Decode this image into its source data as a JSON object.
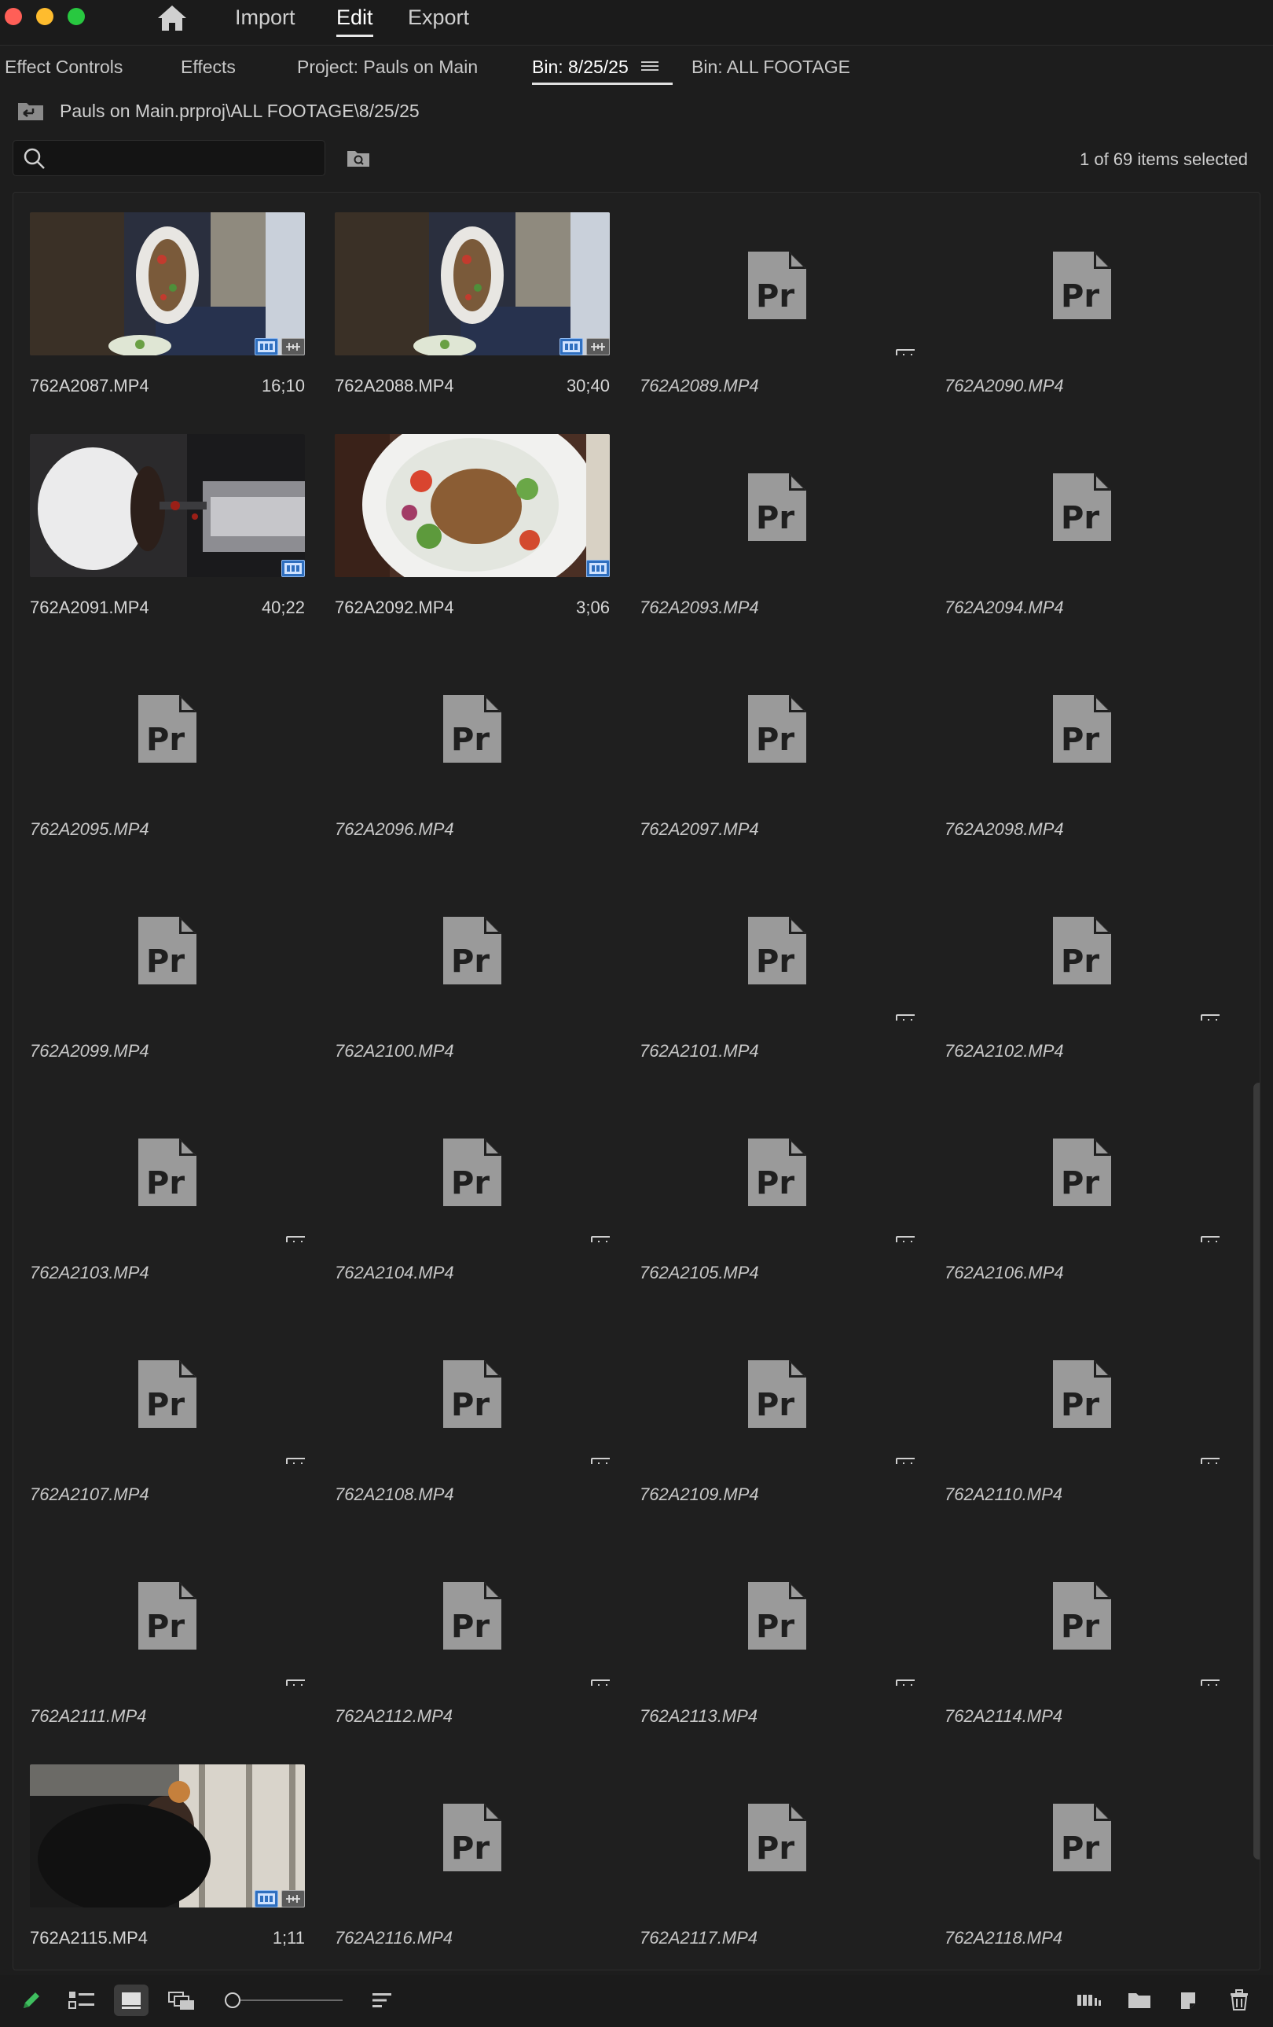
{
  "menu": {
    "tabs": [
      {
        "label": "Import"
      },
      {
        "label": "Edit"
      },
      {
        "label": "Export"
      }
    ]
  },
  "panel_tabs": [
    {
      "label": "Effect Controls"
    },
    {
      "label": "Effects"
    },
    {
      "label": "Project: Pauls on Main"
    },
    {
      "label": "Bin: 8/25/25"
    },
    {
      "label": "Bin: ALL FOOTAGE"
    }
  ],
  "breadcrumb": {
    "path": "Pauls on Main.prproj\\ALL FOOTAGE\\8/25/25"
  },
  "search": {
    "value": "",
    "placeholder": ""
  },
  "status": {
    "items_selected": "1 of 69 items selected"
  },
  "clips": [
    {
      "name": "762A2087.MP4",
      "duration": "16;10",
      "thumbnail": "salad-top",
      "online": true,
      "badges": [
        "video",
        "audio"
      ]
    },
    {
      "name": "762A2088.MP4",
      "duration": "30;40",
      "thumbnail": "salad-top",
      "online": true,
      "badges": [
        "video",
        "audio"
      ]
    },
    {
      "name": "762A2089.MP4",
      "duration": "",
      "thumbnail": "premiere-file-icon",
      "online": false,
      "badges": [
        "audio"
      ]
    },
    {
      "name": "762A2090.MP4",
      "duration": "",
      "thumbnail": "premiere-file-icon",
      "online": false,
      "badges": []
    },
    {
      "name": "762A2091.MP4",
      "duration": "40;22",
      "thumbnail": "coffee-cup",
      "online": true,
      "badges": [
        "video"
      ]
    },
    {
      "name": "762A2092.MP4",
      "duration": "3;06",
      "thumbnail": "salad-plate",
      "online": true,
      "badges": [
        "video"
      ]
    },
    {
      "name": "762A2093.MP4",
      "duration": "",
      "thumbnail": "premiere-file-icon",
      "online": false,
      "badges": []
    },
    {
      "name": "762A2094.MP4",
      "duration": "",
      "thumbnail": "premiere-file-icon",
      "online": false,
      "badges": []
    },
    {
      "name": "762A2095.MP4",
      "duration": "",
      "thumbnail": "premiere-file-icon",
      "online": false,
      "badges": []
    },
    {
      "name": "762A2096.MP4",
      "duration": "",
      "thumbnail": "premiere-file-icon",
      "online": false,
      "badges": []
    },
    {
      "name": "762A2097.MP4",
      "duration": "",
      "thumbnail": "premiere-file-icon",
      "online": false,
      "badges": []
    },
    {
      "name": "762A2098.MP4",
      "duration": "",
      "thumbnail": "premiere-file-icon",
      "online": false,
      "badges": []
    },
    {
      "name": "762A2099.MP4",
      "duration": "",
      "thumbnail": "premiere-file-icon",
      "online": false,
      "badges": []
    },
    {
      "name": "762A2100.MP4",
      "duration": "",
      "thumbnail": "premiere-file-icon",
      "online": false,
      "badges": []
    },
    {
      "name": "762A2101.MP4",
      "duration": "",
      "thumbnail": "premiere-file-icon",
      "online": false,
      "badges": [
        "audio"
      ]
    },
    {
      "name": "762A2102.MP4",
      "duration": "",
      "thumbnail": "premiere-file-icon",
      "online": false,
      "badges": [
        "audio"
      ]
    },
    {
      "name": "762A2103.MP4",
      "duration": "",
      "thumbnail": "premiere-file-icon",
      "online": false,
      "badges": [
        "audio"
      ]
    },
    {
      "name": "762A2104.MP4",
      "duration": "",
      "thumbnail": "premiere-file-icon",
      "online": false,
      "badges": [
        "audio"
      ]
    },
    {
      "name": "762A2105.MP4",
      "duration": "",
      "thumbnail": "premiere-file-icon",
      "online": false,
      "badges": [
        "audio"
      ]
    },
    {
      "name": "762A2106.MP4",
      "duration": "",
      "thumbnail": "premiere-file-icon",
      "online": false,
      "badges": [
        "audio"
      ]
    },
    {
      "name": "762A2107.MP4",
      "duration": "",
      "thumbnail": "premiere-file-icon",
      "online": false,
      "badges": [
        "audio"
      ]
    },
    {
      "name": "762A2108.MP4",
      "duration": "",
      "thumbnail": "premiere-file-icon",
      "online": false,
      "badges": [
        "audio"
      ]
    },
    {
      "name": "762A2109.MP4",
      "duration": "",
      "thumbnail": "premiere-file-icon",
      "online": false,
      "badges": [
        "audio"
      ]
    },
    {
      "name": "762A2110.MP4",
      "duration": "",
      "thumbnail": "premiere-file-icon",
      "online": false,
      "badges": [
        "audio"
      ]
    },
    {
      "name": "762A2111.MP4",
      "duration": "",
      "thumbnail": "premiere-file-icon",
      "online": false,
      "badges": [
        "audio"
      ]
    },
    {
      "name": "762A2112.MP4",
      "duration": "",
      "thumbnail": "premiere-file-icon",
      "online": false,
      "badges": [
        "audio"
      ]
    },
    {
      "name": "762A2113.MP4",
      "duration": "",
      "thumbnail": "premiere-file-icon",
      "online": false,
      "badges": [
        "audio"
      ]
    },
    {
      "name": "762A2114.MP4",
      "duration": "",
      "thumbnail": "premiere-file-icon",
      "online": false,
      "badges": [
        "audio"
      ]
    },
    {
      "name": "762A2115.MP4",
      "duration": "1;11",
      "thumbnail": "person-window",
      "online": true,
      "badges": [
        "video",
        "audio"
      ]
    },
    {
      "name": "762A2116.MP4",
      "duration": "",
      "thumbnail": "premiere-file-icon",
      "online": false,
      "badges": []
    },
    {
      "name": "762A2117.MP4",
      "duration": "",
      "thumbnail": "premiere-file-icon",
      "online": false,
      "badges": []
    },
    {
      "name": "762A2118.MP4",
      "duration": "",
      "thumbnail": "premiere-file-icon",
      "online": false,
      "badges": []
    }
  ],
  "bottom_toolbar": {
    "icons": [
      "pencil-icon",
      "list-view-icon",
      "icon-view-icon",
      "freeform-view-icon",
      "zoom-slider",
      "sort-icon",
      "automate-to-sequence-icon",
      "new-bin-icon",
      "new-item-icon",
      "trash-icon"
    ]
  },
  "colors": {
    "background": "#1d1d1d",
    "panel": "#1f1f1f",
    "video_badge": "#2f6fbf",
    "file_icon": "#9a9a9a"
  }
}
